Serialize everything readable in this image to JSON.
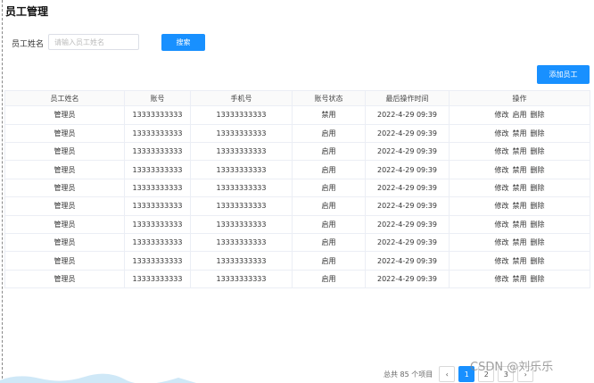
{
  "page_title": "员工管理",
  "search": {
    "label": "员工姓名",
    "placeholder": "请输入员工姓名",
    "button_label": "搜索"
  },
  "add_button_label": "添加员工",
  "table": {
    "headers": [
      "员工姓名",
      "账号",
      "手机号",
      "账号状态",
      "最后操作时间",
      "操作"
    ],
    "rows": [
      {
        "name": "管理员",
        "account": "13333333333",
        "phone": "13333333333",
        "status": "禁用",
        "time": "2022-4-29 09:39",
        "toggle": "启用"
      },
      {
        "name": "管理员",
        "account": "13333333333",
        "phone": "13333333333",
        "status": "启用",
        "time": "2022-4-29 09:39",
        "toggle": "禁用"
      },
      {
        "name": "管理员",
        "account": "13333333333",
        "phone": "13333333333",
        "status": "启用",
        "time": "2022-4-29 09:39",
        "toggle": "禁用"
      },
      {
        "name": "管理员",
        "account": "13333333333",
        "phone": "13333333333",
        "status": "启用",
        "time": "2022-4-29 09:39",
        "toggle": "禁用"
      },
      {
        "name": "管理员",
        "account": "13333333333",
        "phone": "13333333333",
        "status": "启用",
        "time": "2022-4-29 09:39",
        "toggle": "禁用"
      },
      {
        "name": "管理员",
        "account": "13333333333",
        "phone": "13333333333",
        "status": "启用",
        "time": "2022-4-29 09:39",
        "toggle": "禁用"
      },
      {
        "name": "管理员",
        "account": "13333333333",
        "phone": "13333333333",
        "status": "启用",
        "time": "2022-4-29 09:39",
        "toggle": "禁用"
      },
      {
        "name": "管理员",
        "account": "13333333333",
        "phone": "13333333333",
        "status": "启用",
        "time": "2022-4-29 09:39",
        "toggle": "禁用"
      },
      {
        "name": "管理员",
        "account": "13333333333",
        "phone": "13333333333",
        "status": "启用",
        "time": "2022-4-29 09:39",
        "toggle": "禁用"
      },
      {
        "name": "管理员",
        "account": "13333333333",
        "phone": "13333333333",
        "status": "启用",
        "time": "2022-4-29 09:39",
        "toggle": "禁用"
      }
    ],
    "op_edit": "修改",
    "op_delete": "删除"
  },
  "pagination": {
    "total_text": "总共 85 个项目",
    "pages": [
      "1",
      "2",
      "3"
    ],
    "prev": "‹",
    "next": "›"
  },
  "watermark": "CSDN @刘乐乐",
  "colors": {
    "primary": "#1890ff",
    "border": "#ebeef5"
  }
}
